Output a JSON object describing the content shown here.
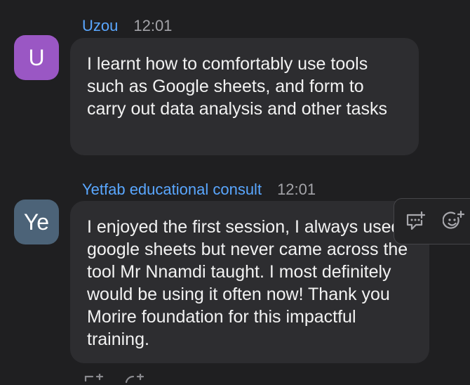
{
  "messages": [
    {
      "avatar_initials": "U",
      "sender": "Uzou",
      "time": "12:01",
      "text": "I learnt how to comfortably use tools such as Google sheets, and form to carry out data analysis and other tasks",
      "avatar_color": "#9a57c4"
    },
    {
      "avatar_initials": "Ye",
      "sender": "Yetfab educational consult",
      "time": "12:01",
      "text": "I enjoyed the first session, I always used google sheets but never came across the tool Mr Nnamdi taught. I most definitely would be using it often now! Thank you Morire foundation for this impactful training.",
      "avatar_color": "#4c6378"
    }
  ],
  "hover_actions": [
    {
      "icon": "reply-icon"
    },
    {
      "icon": "add-reaction-icon"
    }
  ],
  "colors": {
    "background": "#1f1f21",
    "bubble": "#2d2d30",
    "sender_name": "#5aa7ff",
    "timestamp": "#a3a3a8",
    "message_text": "#f2f2f2"
  }
}
